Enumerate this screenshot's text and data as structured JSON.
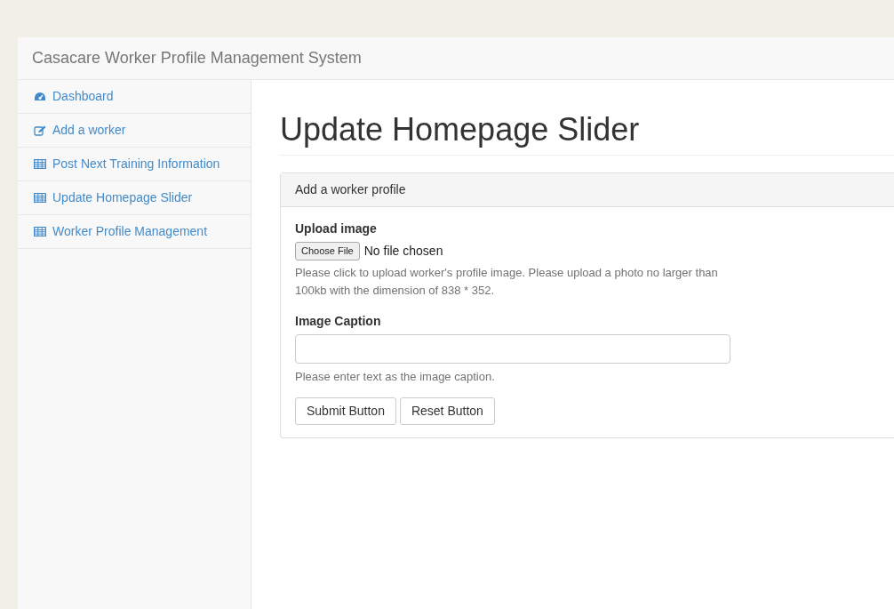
{
  "navbar": {
    "brand": "Casacare Worker Profile Management System"
  },
  "sidebar": {
    "items": [
      {
        "label": "Dashboard",
        "kind": "dashboard"
      },
      {
        "label": "Add a worker",
        "kind": "edit"
      },
      {
        "label": "Post Next Training Information",
        "kind": "table"
      },
      {
        "label": "Update Homepage Slider",
        "kind": "table"
      },
      {
        "label": "Worker Profile Management",
        "kind": "table"
      }
    ]
  },
  "page": {
    "title": "Update Homepage Slider"
  },
  "panel": {
    "heading": "Add a worker profile",
    "upload": {
      "label": "Upload image",
      "button": "Choose File",
      "status": "No file chosen",
      "help": "Please click to upload worker's profile image. Please upload a photo no larger than 100kb with the dimension of 838 * 352."
    },
    "caption": {
      "label": "Image Caption",
      "help": "Please enter text as the image caption."
    },
    "buttons": [
      "Submit Button",
      "Reset Button"
    ]
  }
}
